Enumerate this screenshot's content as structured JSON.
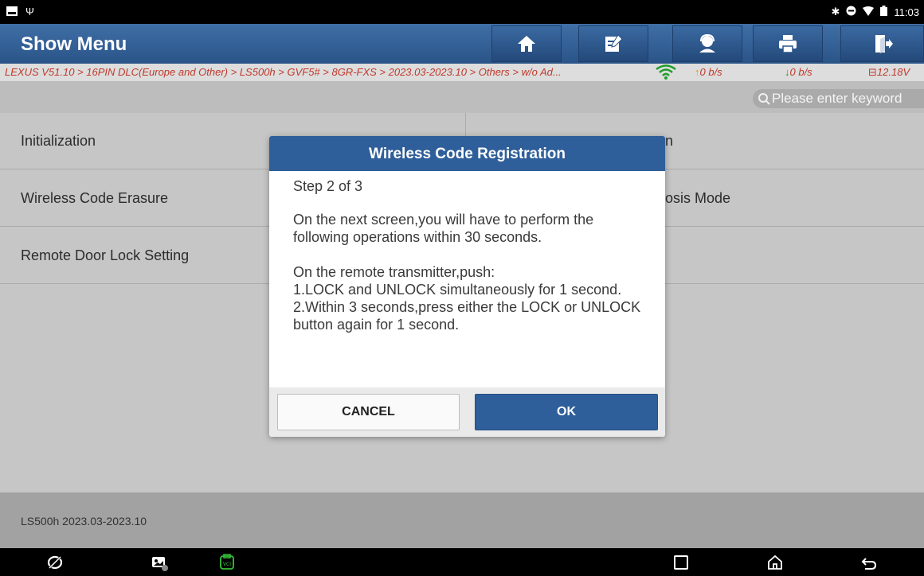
{
  "statusbar": {
    "time": "11:03",
    "left_icons": [
      "screenshot-icon",
      "usb-icon"
    ],
    "right_icons": [
      "bluetooth-icon",
      "dnd-icon",
      "wifi-icon",
      "battery-icon"
    ]
  },
  "header": {
    "title": "Show Menu",
    "buttons": [
      "home-icon",
      "edit-report-icon",
      "remote-support-icon",
      "print-icon",
      "exit-icon"
    ]
  },
  "breadcrumb": {
    "path": "LEXUS V51.10 > 16PIN DLC(Europe and Other) > LS500h > GVF5# > 8GR-FXS > 2023.03-2023.10 > Others > w/o Ad...",
    "upload": "0 b/s",
    "download": "0 b/s",
    "voltage": "12.18V"
  },
  "search": {
    "placeholder": "Please enter keyword"
  },
  "menu": {
    "left": [
      "Initialization",
      "Wireless Code Erasure",
      "Remote Door Lock Setting"
    ],
    "right_visible_fragments": [
      "n",
      "osis Mode"
    ]
  },
  "footer": {
    "info": "LS500h 2023.03-2023.10"
  },
  "dialog": {
    "title": "Wireless Code Registration",
    "step": "Step 2 of 3",
    "para1": "On the next screen,you will have to perform the following operations within 30 seconds.",
    "para2_line1": "On the remote transmitter,push:",
    "para2_line2": "1.LOCK and UNLOCK simultaneously for 1 second.",
    "para2_line3": "2.Within 3 seconds,press either the LOCK or UNLOCK button again for 1 second.",
    "cancel_label": "CANCEL",
    "ok_label": "OK"
  },
  "colors": {
    "header_blue": "#2f5f9a",
    "breadcrumb_red": "#c0392b",
    "upload_arrow": "#e69b00",
    "download_arrow": "#1e9e2a",
    "vci_green": "#35c13a"
  }
}
